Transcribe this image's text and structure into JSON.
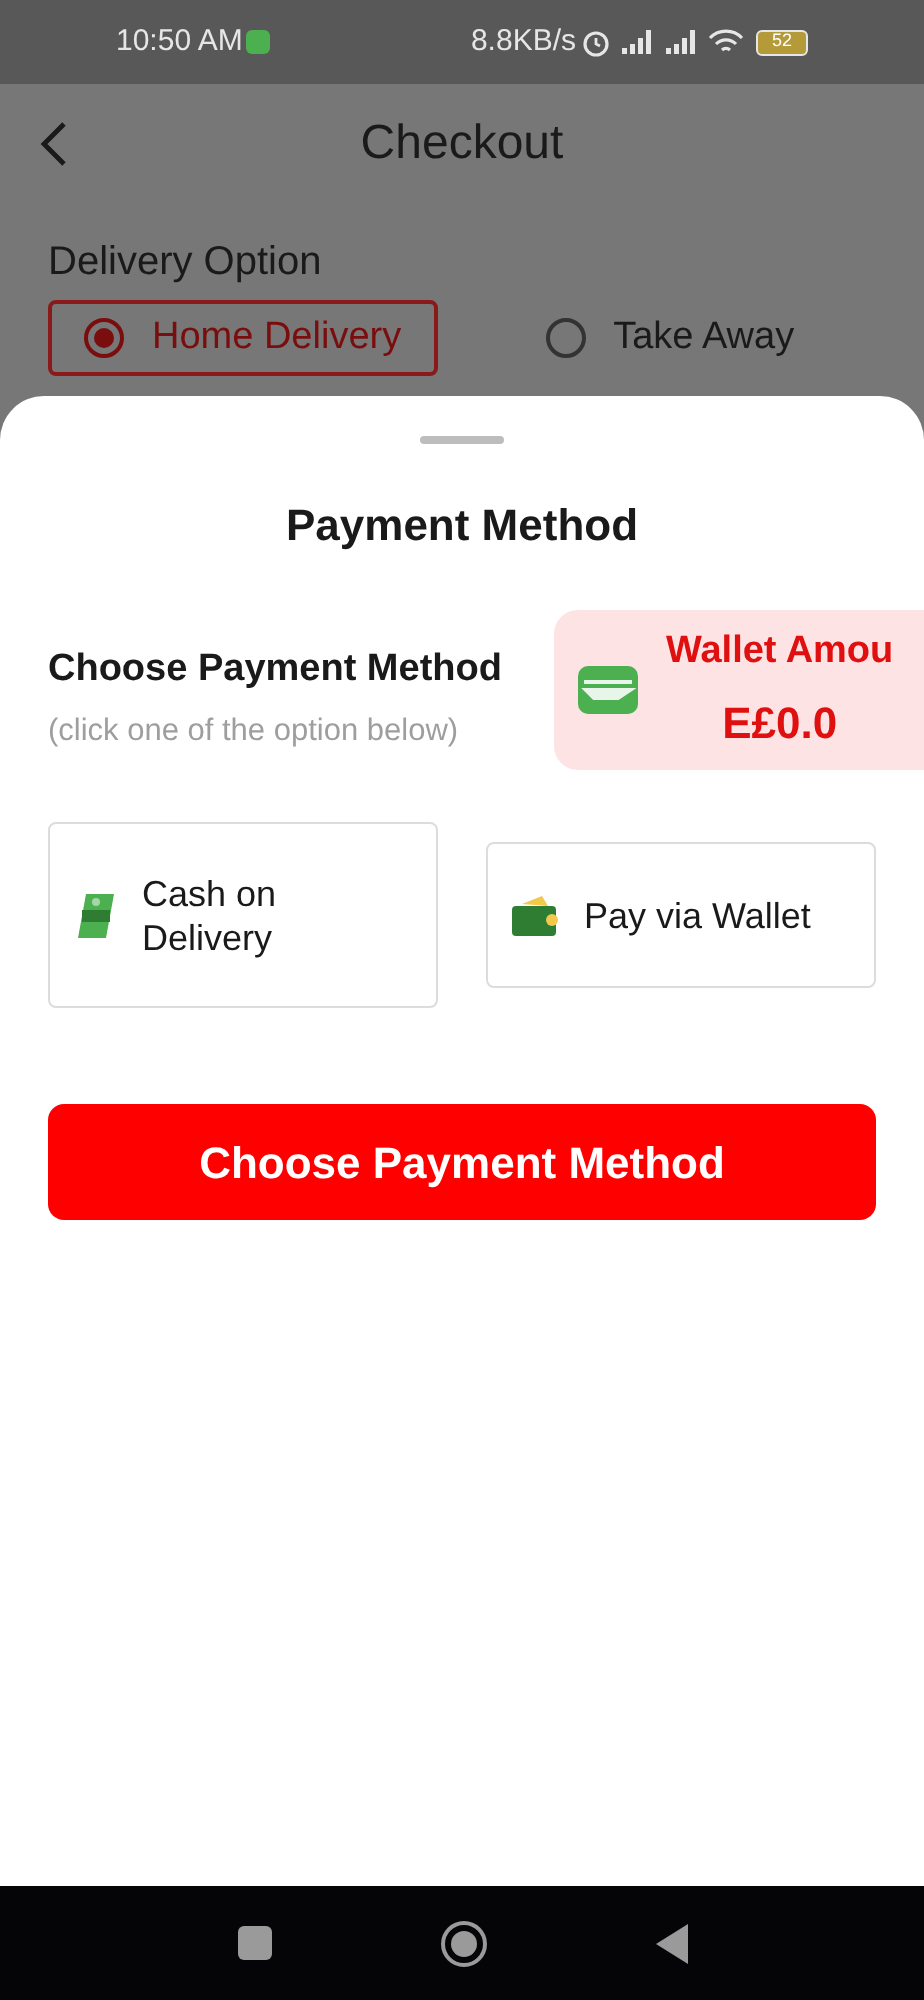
{
  "status_bar": {
    "time": "10:50 AM",
    "speed": "8.8KB/s",
    "battery": "52"
  },
  "header": {
    "title": "Checkout"
  },
  "delivery": {
    "label": "Delivery Option",
    "options": [
      {
        "label": "Home Delivery",
        "selected": true
      },
      {
        "label": "Take Away",
        "selected": false
      }
    ]
  },
  "sheet": {
    "title": "Payment Method",
    "heading": "Choose Payment Method",
    "subtitle": "(click one of the option below)",
    "wallet": {
      "label": "Wallet Amou",
      "amount": "E£0.0"
    },
    "options": [
      {
        "kind": "cash",
        "label": "Cash on Delivery"
      },
      {
        "kind": "wallet",
        "label": "Pay via Wallet"
      }
    ],
    "button": "Choose Payment Method"
  }
}
